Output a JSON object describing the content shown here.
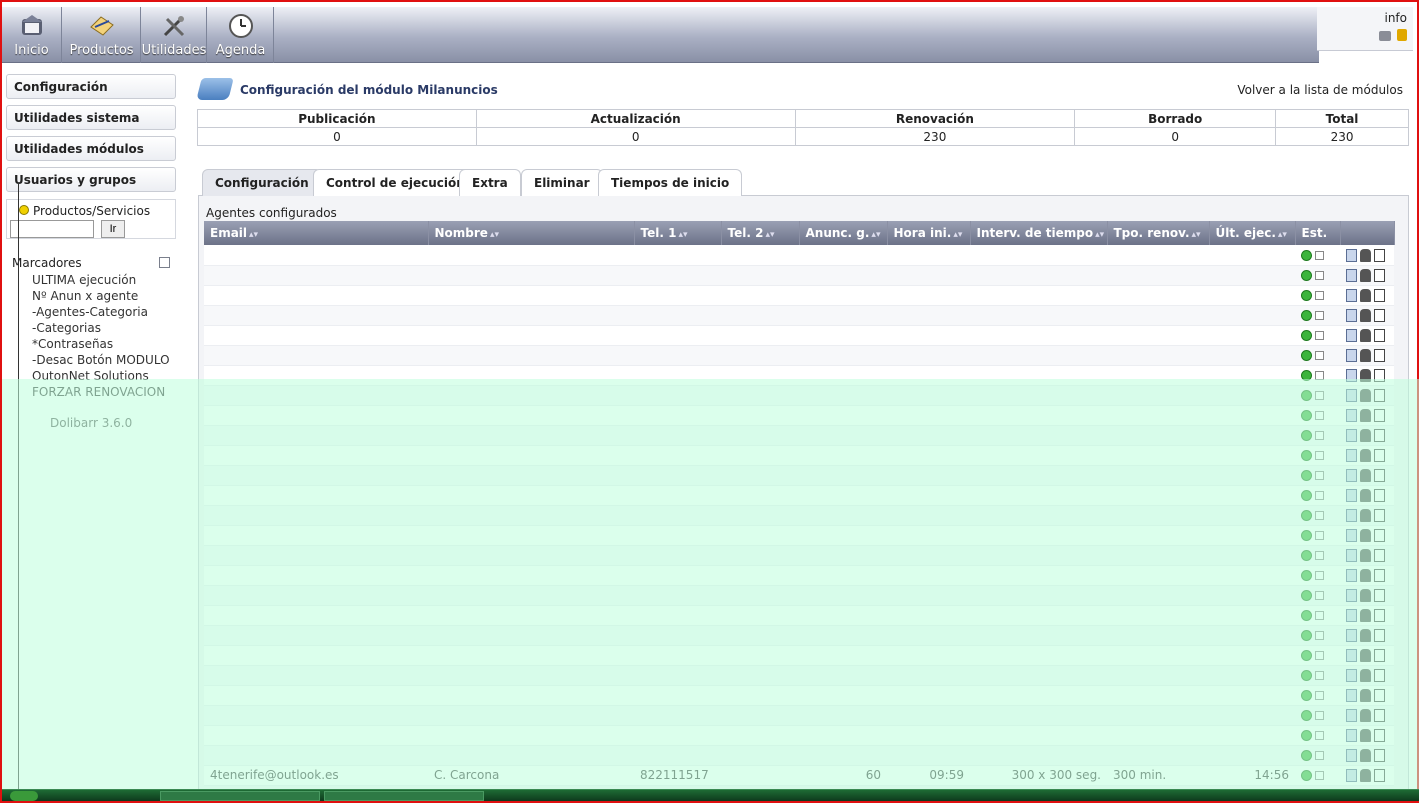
{
  "nav": {
    "items": [
      {
        "label": "Inicio",
        "icon": "home-icon"
      },
      {
        "label": "Productos",
        "icon": "products-icon"
      },
      {
        "label": "Utilidades",
        "icon": "tools-icon"
      },
      {
        "label": "Agenda",
        "icon": "clock-icon"
      }
    ],
    "user": "info"
  },
  "sidebar": {
    "items": [
      {
        "label": "Configuración"
      },
      {
        "label": "Utilidades sistema"
      },
      {
        "label": "Utilidades módulos"
      },
      {
        "label": "Usuarios y grupos"
      }
    ],
    "search": {
      "label": "Productos/Servicios",
      "value": "",
      "button": "Ir"
    },
    "bookmarks_title": "Marcadores",
    "bookmarks": [
      "ULTIMA ejecución",
      "Nº Anun x agente",
      "-Agentes-Categoria",
      "-Categorias",
      "*Contraseñas",
      "-Desac Botón MODULO",
      "OutonNet Solutions",
      "FORZAR RENOVACION"
    ],
    "footer": "Dolibarr 3.6.0"
  },
  "module": {
    "title": "Configuración del módulo Milanuncios",
    "back_link": "Volver a la lista de módulos"
  },
  "stats": {
    "headers": [
      "Publicación",
      "Actualización",
      "Renovación",
      "Borrado",
      "Total"
    ],
    "values": [
      "0",
      "0",
      "230",
      "0",
      "230"
    ]
  },
  "tabs": [
    {
      "label": "Configuración",
      "active": true
    },
    {
      "label": "Control de ejecución",
      "active": false
    },
    {
      "label": "Extra",
      "active": false
    },
    {
      "label": "Eliminar",
      "active": false
    },
    {
      "label": "Tiempos de inicio",
      "active": false
    }
  ],
  "agents": {
    "title": "Agentes configurados",
    "columns": [
      "Email",
      "Nombre",
      "Tel. 1",
      "Tel. 2",
      "Anunc. g.",
      "Hora ini.",
      "Interv. de tiempo",
      "Tpo. renov.",
      "Últ. ejec.",
      "Est."
    ],
    "last_row": {
      "email": "4tenerife@outlook.es",
      "name": "C. Carcona",
      "tel1": "822111517",
      "tel2": "",
      "ads": "60",
      "start": "09:59",
      "interval": "300 x 300 seg.",
      "renew": "300 min.",
      "last": "14:56"
    }
  },
  "colors": {
    "nav_top": "#eef0f6",
    "nav_bottom": "#8990a6",
    "grid_header": "#6c7288",
    "overlay": "#beffdc",
    "state_ok": "#3cb43c"
  }
}
